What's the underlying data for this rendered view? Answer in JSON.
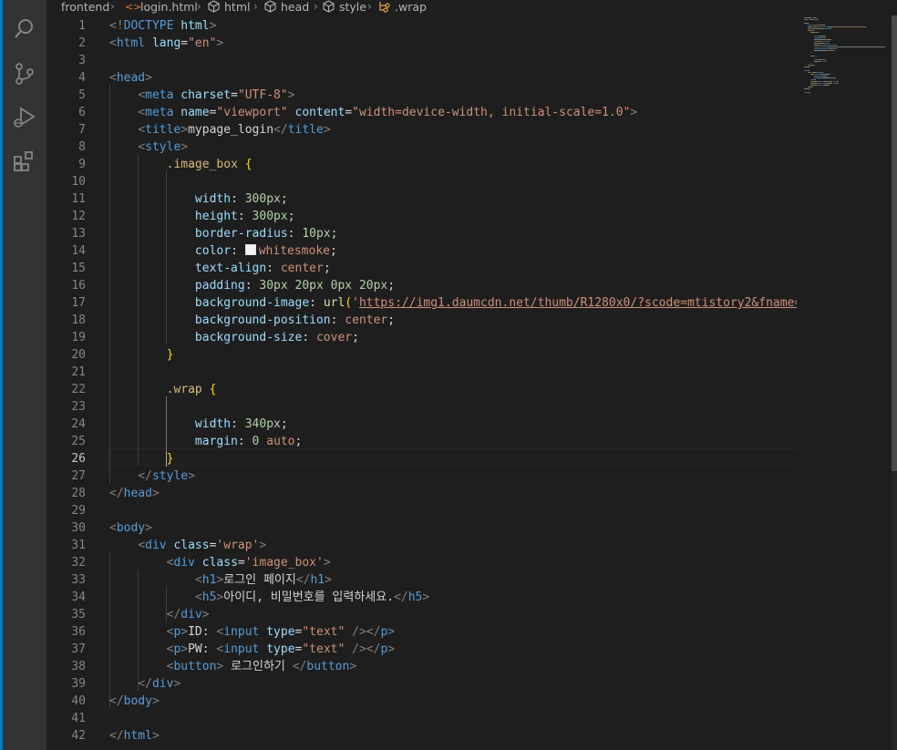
{
  "breadcrumbs": [
    "frontend",
    "login.html",
    "html",
    "head",
    "style",
    ".wrap"
  ],
  "activity_bar": [
    "explorer-icon",
    "source-control-icon",
    "run-debug-icon",
    "extensions-icon"
  ],
  "colors": {
    "accent": "#007acc",
    "tag": "#569cd6",
    "attr": "#9cdcfe",
    "string": "#ce9178",
    "selector": "#d7ba7d",
    "number": "#b5cea8",
    "bracket": "#ffd700"
  },
  "active_line": 26,
  "lines": [
    {
      "n": "1",
      "tokens": [
        [
          "t-brk",
          "<!"
        ],
        [
          "t-tag",
          "DOCTYPE"
        ],
        [
          "t-txt",
          " "
        ],
        [
          "t-att",
          "html"
        ],
        [
          "t-brk",
          ">"
        ]
      ]
    },
    {
      "n": "2",
      "tokens": [
        [
          "t-brk",
          "<"
        ],
        [
          "t-tag",
          "html"
        ],
        [
          "t-txt",
          " "
        ],
        [
          "t-att",
          "lang"
        ],
        [
          "t-txt",
          "="
        ],
        [
          "t-str",
          "\"en\""
        ],
        [
          "t-brk",
          ">"
        ]
      ]
    },
    {
      "n": "3",
      "tokens": []
    },
    {
      "n": "4",
      "tokens": [
        [
          "t-brk",
          "<"
        ],
        [
          "t-tag",
          "head"
        ],
        [
          "t-brk",
          ">"
        ]
      ]
    },
    {
      "n": "5",
      "tokens": [
        [
          "t-txt",
          "    "
        ],
        [
          "t-brk",
          "<"
        ],
        [
          "t-tag",
          "meta"
        ],
        [
          "t-txt",
          " "
        ],
        [
          "t-att",
          "charset"
        ],
        [
          "t-txt",
          "="
        ],
        [
          "t-str",
          "\"UTF-8\""
        ],
        [
          "t-brk",
          ">"
        ]
      ]
    },
    {
      "n": "6",
      "tokens": [
        [
          "t-txt",
          "    "
        ],
        [
          "t-brk",
          "<"
        ],
        [
          "t-tag",
          "meta"
        ],
        [
          "t-txt",
          " "
        ],
        [
          "t-att",
          "name"
        ],
        [
          "t-txt",
          "="
        ],
        [
          "t-str",
          "\"viewport\""
        ],
        [
          "t-txt",
          " "
        ],
        [
          "t-att",
          "content"
        ],
        [
          "t-txt",
          "="
        ],
        [
          "t-str",
          "\"width=device-width, initial-scale=1.0\""
        ],
        [
          "t-brk",
          ">"
        ]
      ]
    },
    {
      "n": "7",
      "tokens": [
        [
          "t-txt",
          "    "
        ],
        [
          "t-brk",
          "<"
        ],
        [
          "t-tag",
          "title"
        ],
        [
          "t-brk",
          ">"
        ],
        [
          "t-txt",
          "mypage_login"
        ],
        [
          "t-brk",
          "</"
        ],
        [
          "t-tag",
          "title"
        ],
        [
          "t-brk",
          ">"
        ]
      ]
    },
    {
      "n": "8",
      "tokens": [
        [
          "t-txt",
          "    "
        ],
        [
          "t-brk",
          "<"
        ],
        [
          "t-tag",
          "style"
        ],
        [
          "t-brk",
          ">"
        ]
      ]
    },
    {
      "n": "9",
      "tokens": [
        [
          "t-txt",
          "        "
        ],
        [
          "t-sel",
          ".image_box"
        ],
        [
          "t-txt",
          " "
        ],
        [
          "t-br",
          "{"
        ]
      ]
    },
    {
      "n": "10",
      "tokens": []
    },
    {
      "n": "11",
      "tokens": [
        [
          "t-txt",
          "            "
        ],
        [
          "t-prop",
          "width"
        ],
        [
          "t-txt",
          ": "
        ],
        [
          "t-num",
          "300px"
        ],
        [
          "t-txt",
          ";"
        ]
      ]
    },
    {
      "n": "12",
      "tokens": [
        [
          "t-txt",
          "            "
        ],
        [
          "t-prop",
          "height"
        ],
        [
          "t-txt",
          ": "
        ],
        [
          "t-num",
          "300px"
        ],
        [
          "t-txt",
          ";"
        ]
      ]
    },
    {
      "n": "13",
      "tokens": [
        [
          "t-txt",
          "            "
        ],
        [
          "t-prop",
          "border-radius"
        ],
        [
          "t-txt",
          ": "
        ],
        [
          "t-num",
          "10px"
        ],
        [
          "t-txt",
          ";"
        ]
      ]
    },
    {
      "n": "14",
      "tokens": [
        [
          "t-txt",
          "            "
        ],
        [
          "t-prop",
          "color"
        ],
        [
          "t-txt",
          ": "
        ],
        [
          "swatch",
          ""
        ],
        [
          "t-val",
          "whitesmoke"
        ],
        [
          "t-txt",
          ";"
        ]
      ]
    },
    {
      "n": "15",
      "tokens": [
        [
          "t-txt",
          "            "
        ],
        [
          "t-prop",
          "text-align"
        ],
        [
          "t-txt",
          ": "
        ],
        [
          "t-val",
          "center"
        ],
        [
          "t-txt",
          ";"
        ]
      ]
    },
    {
      "n": "16",
      "tokens": [
        [
          "t-txt",
          "            "
        ],
        [
          "t-prop",
          "padding"
        ],
        [
          "t-txt",
          ": "
        ],
        [
          "t-num",
          "30px 20px 0px 20px"
        ],
        [
          "t-txt",
          ";"
        ]
      ]
    },
    {
      "n": "17",
      "tokens": [
        [
          "t-txt",
          "            "
        ],
        [
          "t-prop",
          "background-image"
        ],
        [
          "t-txt",
          ": "
        ],
        [
          "t-fn",
          "url"
        ],
        [
          "t-br",
          "("
        ],
        [
          "t-str",
          "'"
        ],
        [
          "t-url",
          "https://img1.daumcdn.net/thumb/R1280x0/?scode=mtistory2&fname=h"
        ]
      ]
    },
    {
      "n": "18",
      "tokens": [
        [
          "t-txt",
          "            "
        ],
        [
          "t-prop",
          "background-position"
        ],
        [
          "t-txt",
          ": "
        ],
        [
          "t-val",
          "center"
        ],
        [
          "t-txt",
          ";"
        ]
      ]
    },
    {
      "n": "19",
      "tokens": [
        [
          "t-txt",
          "            "
        ],
        [
          "t-prop",
          "background-size"
        ],
        [
          "t-txt",
          ": "
        ],
        [
          "t-val",
          "cover"
        ],
        [
          "t-txt",
          ";"
        ]
      ]
    },
    {
      "n": "20",
      "tokens": [
        [
          "t-txt",
          "        "
        ],
        [
          "t-br",
          "}"
        ]
      ]
    },
    {
      "n": "21",
      "tokens": []
    },
    {
      "n": "22",
      "tokens": [
        [
          "t-txt",
          "        "
        ],
        [
          "t-sel",
          ".wrap"
        ],
        [
          "t-txt",
          " "
        ],
        [
          "t-br",
          "{"
        ]
      ]
    },
    {
      "n": "23",
      "tokens": []
    },
    {
      "n": "24",
      "tokens": [
        [
          "t-txt",
          "            "
        ],
        [
          "t-prop",
          "width"
        ],
        [
          "t-txt",
          ": "
        ],
        [
          "t-num",
          "340px"
        ],
        [
          "t-txt",
          ";"
        ]
      ]
    },
    {
      "n": "25",
      "tokens": [
        [
          "t-txt",
          "            "
        ],
        [
          "t-prop",
          "margin"
        ],
        [
          "t-txt",
          ": "
        ],
        [
          "t-num",
          "0"
        ],
        [
          "t-txt",
          " "
        ],
        [
          "t-val",
          "auto"
        ],
        [
          "t-txt",
          ";"
        ]
      ]
    },
    {
      "n": "26",
      "tokens": [
        [
          "t-txt",
          "        "
        ],
        [
          "t-br",
          "}"
        ]
      ]
    },
    {
      "n": "27",
      "tokens": [
        [
          "t-txt",
          "    "
        ],
        [
          "t-brk",
          "</"
        ],
        [
          "t-tag",
          "style"
        ],
        [
          "t-brk",
          ">"
        ]
      ]
    },
    {
      "n": "28",
      "tokens": [
        [
          "t-brk",
          "</"
        ],
        [
          "t-tag",
          "head"
        ],
        [
          "t-brk",
          ">"
        ]
      ]
    },
    {
      "n": "29",
      "tokens": []
    },
    {
      "n": "30",
      "tokens": [
        [
          "t-brk",
          "<"
        ],
        [
          "t-tag",
          "body"
        ],
        [
          "t-brk",
          ">"
        ]
      ]
    },
    {
      "n": "31",
      "tokens": [
        [
          "t-txt",
          "    "
        ],
        [
          "t-brk",
          "<"
        ],
        [
          "t-tag",
          "div"
        ],
        [
          "t-txt",
          " "
        ],
        [
          "t-att",
          "class"
        ],
        [
          "t-txt",
          "="
        ],
        [
          "t-str",
          "'wrap'"
        ],
        [
          "t-brk",
          ">"
        ]
      ]
    },
    {
      "n": "32",
      "tokens": [
        [
          "t-txt",
          "        "
        ],
        [
          "t-brk",
          "<"
        ],
        [
          "t-tag",
          "div"
        ],
        [
          "t-txt",
          " "
        ],
        [
          "t-att",
          "class"
        ],
        [
          "t-txt",
          "="
        ],
        [
          "t-str",
          "'image_box'"
        ],
        [
          "t-brk",
          ">"
        ]
      ]
    },
    {
      "n": "33",
      "tokens": [
        [
          "t-txt",
          "            "
        ],
        [
          "t-brk",
          "<"
        ],
        [
          "t-tag",
          "h1"
        ],
        [
          "t-brk",
          ">"
        ],
        [
          "t-txt",
          "로그인 페이지"
        ],
        [
          "t-brk",
          "</"
        ],
        [
          "t-tag",
          "h1"
        ],
        [
          "t-brk",
          ">"
        ]
      ]
    },
    {
      "n": "34",
      "tokens": [
        [
          "t-txt",
          "            "
        ],
        [
          "t-brk",
          "<"
        ],
        [
          "t-tag",
          "h5"
        ],
        [
          "t-brk",
          ">"
        ],
        [
          "t-txt",
          "아이디, 비밀번호를 입력하세요."
        ],
        [
          "t-brk",
          "</"
        ],
        [
          "t-tag",
          "h5"
        ],
        [
          "t-brk",
          ">"
        ]
      ]
    },
    {
      "n": "35",
      "tokens": [
        [
          "t-txt",
          "        "
        ],
        [
          "t-brk",
          "</"
        ],
        [
          "t-tag",
          "div"
        ],
        [
          "t-brk",
          ">"
        ]
      ]
    },
    {
      "n": "36",
      "tokens": [
        [
          "t-txt",
          "        "
        ],
        [
          "t-brk",
          "<"
        ],
        [
          "t-tag",
          "p"
        ],
        [
          "t-brk",
          ">"
        ],
        [
          "t-txt",
          "ID: "
        ],
        [
          "t-brk",
          "<"
        ],
        [
          "t-tag",
          "input"
        ],
        [
          "t-txt",
          " "
        ],
        [
          "t-att",
          "type"
        ],
        [
          "t-txt",
          "="
        ],
        [
          "t-str",
          "\"text\""
        ],
        [
          "t-txt",
          " "
        ],
        [
          "t-brk",
          "/></"
        ],
        [
          "t-tag",
          "p"
        ],
        [
          "t-brk",
          ">"
        ]
      ]
    },
    {
      "n": "37",
      "tokens": [
        [
          "t-txt",
          "        "
        ],
        [
          "t-brk",
          "<"
        ],
        [
          "t-tag",
          "p"
        ],
        [
          "t-brk",
          ">"
        ],
        [
          "t-txt",
          "PW: "
        ],
        [
          "t-brk",
          "<"
        ],
        [
          "t-tag",
          "input"
        ],
        [
          "t-txt",
          " "
        ],
        [
          "t-att",
          "type"
        ],
        [
          "t-txt",
          "="
        ],
        [
          "t-str",
          "\"text\""
        ],
        [
          "t-txt",
          " "
        ],
        [
          "t-brk",
          "/></"
        ],
        [
          "t-tag",
          "p"
        ],
        [
          "t-brk",
          ">"
        ]
      ]
    },
    {
      "n": "38",
      "tokens": [
        [
          "t-txt",
          "        "
        ],
        [
          "t-brk",
          "<"
        ],
        [
          "t-tag",
          "button"
        ],
        [
          "t-brk",
          ">"
        ],
        [
          "t-txt",
          " 로그인하기 "
        ],
        [
          "t-brk",
          "</"
        ],
        [
          "t-tag",
          "button"
        ],
        [
          "t-brk",
          ">"
        ]
      ]
    },
    {
      "n": "39",
      "tokens": [
        [
          "t-txt",
          "    "
        ],
        [
          "t-brk",
          "</"
        ],
        [
          "t-tag",
          "div"
        ],
        [
          "t-brk",
          ">"
        ]
      ]
    },
    {
      "n": "40",
      "tokens": [
        [
          "t-brk",
          "</"
        ],
        [
          "t-tag",
          "body"
        ],
        [
          "t-brk",
          ">"
        ]
      ]
    },
    {
      "n": "41",
      "tokens": []
    },
    {
      "n": "42",
      "tokens": [
        [
          "t-brk",
          "</"
        ],
        [
          "t-tag",
          "html"
        ],
        [
          "t-brk",
          ">"
        ]
      ]
    }
  ]
}
